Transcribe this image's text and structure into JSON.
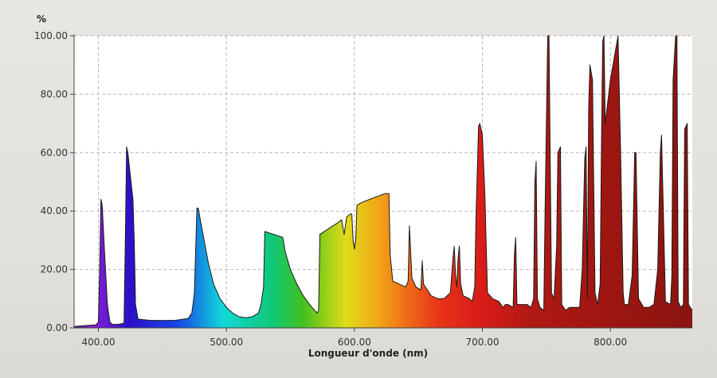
{
  "chart_data": {
    "type": "area",
    "ylabel": "%",
    "xlabel": "Longueur d'onde (nm)",
    "xlim": [
      381,
      864
    ],
    "ylim": [
      0,
      100
    ],
    "x_ticks": [
      "400.00",
      "500.00",
      "600.00",
      "700.00",
      "800.00"
    ],
    "x_tick_values": [
      400,
      500,
      600,
      700,
      800
    ],
    "y_ticks": [
      "0.00",
      "20.00",
      "40.00",
      "60.00",
      "80.00",
      "100.00"
    ],
    "y_tick_values": [
      0,
      20,
      40,
      60,
      80,
      100
    ],
    "grid": true,
    "fill": "spectral gradient (violet to deep red)",
    "series": [
      {
        "points": [
          [
            381,
            0.5
          ],
          [
            390,
            0.8
          ],
          [
            398,
            1.0
          ],
          [
            400,
            2
          ],
          [
            401,
            20
          ],
          [
            402,
            44
          ],
          [
            403,
            42
          ],
          [
            405,
            24
          ],
          [
            407,
            8
          ],
          [
            409,
            2
          ],
          [
            411,
            1.2
          ],
          [
            415,
            1.2
          ],
          [
            419,
            1.5
          ],
          [
            420,
            1.7
          ],
          [
            421,
            30
          ],
          [
            422,
            62
          ],
          [
            423,
            60
          ],
          [
            425,
            52
          ],
          [
            427,
            44
          ],
          [
            428,
            30
          ],
          [
            429,
            8
          ],
          [
            431,
            3
          ],
          [
            440,
            2.6
          ],
          [
            450,
            2.5
          ],
          [
            460,
            2.6
          ],
          [
            470,
            3.2
          ],
          [
            473,
            5
          ],
          [
            475,
            12
          ],
          [
            477,
            41
          ],
          [
            478,
            41
          ],
          [
            480,
            36
          ],
          [
            483,
            29
          ],
          [
            486,
            22
          ],
          [
            490,
            15
          ],
          [
            495,
            10
          ],
          [
            500,
            7
          ],
          [
            505,
            5
          ],
          [
            510,
            3.8
          ],
          [
            515,
            3.5
          ],
          [
            520,
            3.8
          ],
          [
            525,
            5
          ],
          [
            527,
            8
          ],
          [
            529,
            14
          ],
          [
            530,
            33
          ],
          [
            537,
            32
          ],
          [
            544,
            31
          ],
          [
            546,
            26
          ],
          [
            550,
            20
          ],
          [
            555,
            15
          ],
          [
            560,
            11
          ],
          [
            565,
            8
          ],
          [
            569,
            6
          ],
          [
            571,
            5
          ],
          [
            572,
            6
          ],
          [
            573,
            32
          ],
          [
            580,
            34
          ],
          [
            587,
            36
          ],
          [
            590,
            37
          ],
          [
            592,
            32
          ],
          [
            594,
            38
          ],
          [
            597,
            39
          ],
          [
            598,
            39
          ],
          [
            599,
            30
          ],
          [
            600,
            27
          ],
          [
            601,
            30
          ],
          [
            602,
            42
          ],
          [
            606,
            43
          ],
          [
            612,
            44
          ],
          [
            618,
            45
          ],
          [
            624,
            46
          ],
          [
            627,
            46
          ],
          [
            628,
            25
          ],
          [
            630,
            16
          ],
          [
            635,
            15
          ],
          [
            640,
            14
          ],
          [
            642,
            16
          ],
          [
            643,
            35
          ],
          [
            644,
            26
          ],
          [
            645,
            17
          ],
          [
            648,
            14
          ],
          [
            652,
            13
          ],
          [
            653,
            23
          ],
          [
            654,
            15
          ],
          [
            660,
            11
          ],
          [
            665,
            10
          ],
          [
            670,
            10
          ],
          [
            675,
            12
          ],
          [
            677,
            24
          ],
          [
            678,
            28
          ],
          [
            679,
            18
          ],
          [
            680,
            14
          ],
          [
            681,
            24
          ],
          [
            682,
            28
          ],
          [
            683,
            15
          ],
          [
            685,
            11
          ],
          [
            690,
            10
          ],
          [
            692,
            9
          ],
          [
            694,
            14
          ],
          [
            695,
            38
          ],
          [
            697,
            69
          ],
          [
            698,
            70
          ],
          [
            700,
            66
          ],
          [
            702,
            45
          ],
          [
            704,
            12
          ],
          [
            708,
            10
          ],
          [
            713,
            9
          ],
          [
            716,
            7
          ],
          [
            718,
            8
          ],
          [
            720,
            8
          ],
          [
            724,
            7
          ],
          [
            725,
            25
          ],
          [
            726,
            31
          ],
          [
            727,
            8
          ],
          [
            735,
            8
          ],
          [
            738,
            7
          ],
          [
            740,
            10
          ],
          [
            741,
            50
          ],
          [
            742,
            57
          ],
          [
            743,
            10
          ],
          [
            745,
            7
          ],
          [
            748,
            6
          ],
          [
            749,
            40
          ],
          [
            751,
            100
          ],
          [
            752,
            100
          ],
          [
            754,
            12
          ],
          [
            756,
            10
          ],
          [
            758,
            28
          ],
          [
            759,
            60
          ],
          [
            761,
            62
          ],
          [
            762,
            8
          ],
          [
            765,
            6
          ],
          [
            768,
            7
          ],
          [
            771,
            7
          ],
          [
            776,
            7
          ],
          [
            778,
            20
          ],
          [
            780,
            58
          ],
          [
            781,
            62
          ],
          [
            782,
            10
          ],
          [
            783,
            75
          ],
          [
            784,
            90
          ],
          [
            786,
            85
          ],
          [
            788,
            12
          ],
          [
            790,
            8
          ],
          [
            792,
            15
          ],
          [
            793,
            60
          ],
          [
            794,
            98
          ],
          [
            795,
            100
          ],
          [
            796,
            70
          ],
          [
            800,
            85
          ],
          [
            806,
            100
          ],
          [
            808,
            60
          ],
          [
            810,
            12
          ],
          [
            811,
            8
          ],
          [
            814,
            8
          ],
          [
            817,
            18
          ],
          [
            819,
            60
          ],
          [
            820,
            60
          ],
          [
            822,
            10
          ],
          [
            826,
            7
          ],
          [
            830,
            7
          ],
          [
            834,
            8
          ],
          [
            837,
            20
          ],
          [
            839,
            60
          ],
          [
            840,
            66
          ],
          [
            843,
            9
          ],
          [
            847,
            8
          ],
          [
            848,
            18
          ],
          [
            849,
            85
          ],
          [
            851,
            100
          ],
          [
            852,
            100
          ],
          [
            853,
            9
          ],
          [
            855,
            7
          ],
          [
            857,
            8
          ],
          [
            858,
            68
          ],
          [
            860,
            70
          ],
          [
            861,
            8
          ],
          [
            864,
            6
          ]
        ]
      }
    ]
  }
}
